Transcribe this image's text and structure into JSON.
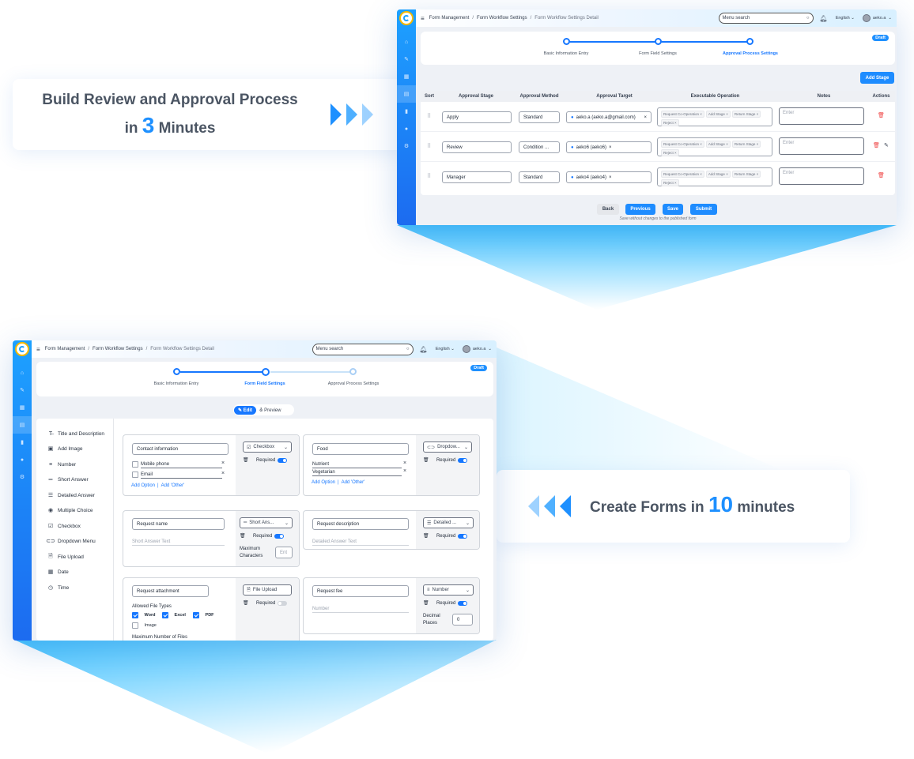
{
  "callout_top": {
    "text_a": "Build Review and Approval Process",
    "text_b": "in",
    "num": "3",
    "text_c": "Minutes"
  },
  "callout_bottom": {
    "text_a": "Create Forms in",
    "num": "10",
    "text_c": "minutes"
  },
  "colors": {
    "accent": "#1e8cff",
    "sidebar_top": "#1da1ff",
    "sidebar_bottom": "#1c6bf0",
    "danger": "#ef4444"
  },
  "common": {
    "breadcrumb": [
      "Form Management",
      "Form Workflow Settings",
      "Form Workflow Settings Detail"
    ],
    "search_placeholder": "Menu search",
    "language": "English",
    "user": "aeko.a",
    "draft": "Draft",
    "steps": [
      "Basic Information Entry",
      "Form Field Settings",
      "Approval Process Settings"
    ]
  },
  "approval": {
    "add_stage": "Add Stage",
    "columns": [
      "Sort",
      "Approval Stage",
      "Approval Method",
      "Approval Target",
      "Executable Operation",
      "Notes",
      "Actions"
    ],
    "rows": [
      {
        "stage": "Apply",
        "method": "Standard",
        "target": "aeko.a (aeko.a@gmail.com)",
        "tags": [
          "Request Co-Operation",
          "Add Stage",
          "Return Stage",
          "Reject"
        ],
        "notes_placeholder": "Enter"
      },
      {
        "stage": "Review",
        "method": "Condition ...",
        "target": "aeko6 (aeko6)",
        "tags": [
          "Request Co-Operation",
          "Add Stage",
          "Return Stage",
          "Reject"
        ],
        "notes_placeholder": "Enter"
      },
      {
        "stage": "Manager",
        "method": "Standard",
        "target": "aeko4 (aeko4)",
        "tags": [
          "Request Co-Operation",
          "Add Stage",
          "Return Stage",
          "Reject"
        ],
        "notes_placeholder": "Enter"
      }
    ],
    "buttons": {
      "back": "Back",
      "previous": "Previous",
      "save": "Save",
      "submit": "Submit"
    },
    "hint": "Save without changes to the published form"
  },
  "form": {
    "edit": "Edit",
    "preview": "Preview",
    "palette": [
      "Title and Description",
      "Add Image",
      "Number",
      "Short Answer",
      "Detailed Answer",
      "Multiple Choice",
      "Checkbox",
      "Dropdown Menu",
      "File Upload",
      "Date",
      "Time"
    ],
    "required": "Required",
    "add_option": "Add Option",
    "add_other": "Add 'Other'",
    "cards": {
      "contact": {
        "title": "Contact information",
        "type": "Checkbox",
        "options": [
          "Mobile phone",
          "Email"
        ]
      },
      "food": {
        "title": "Food",
        "type": "Dropdow...",
        "options": [
          "Nutrient",
          "Vegetarian"
        ]
      },
      "reqname": {
        "title": "Request name",
        "type": "Short Ans...",
        "placeholder": "Short Answer Text",
        "max_chars": "Maximum Characters",
        "max_ph": "Ent"
      },
      "reqdesc": {
        "title": "Request description",
        "type": "Detailed ...",
        "placeholder": "Detailed Answer Text"
      },
      "attach": {
        "title": "Request attachment",
        "type": "File Upload",
        "allowed": "Allowed File Types",
        "types": [
          "Word",
          "Excel",
          "PDF",
          "Image"
        ],
        "max_files": "Maximum Number of Files"
      },
      "fee": {
        "title": "Request fee",
        "type": "Number",
        "placeholder": "Number",
        "decimal": "Decimal Places",
        "decimal_value": "0"
      }
    }
  }
}
